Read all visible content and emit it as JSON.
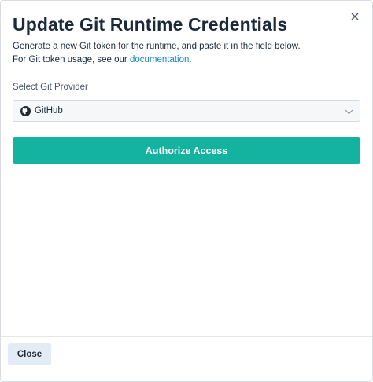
{
  "dialog": {
    "title": "Update Git Runtime Credentials",
    "description_line1": "Generate a new Git token for the runtime, and paste it in the field below.",
    "description_line2_prefix": "For Git token usage, see our ",
    "description_line2_link": "documentation",
    "description_line2_suffix": ".",
    "close_icon": "close-icon"
  },
  "form": {
    "provider_label": "Select Git Provider",
    "provider_value": "GitHub",
    "provider_icon": "github-icon",
    "chevron_icon": "chevron-down-icon"
  },
  "actions": {
    "authorize_label": "Authorize Access",
    "close_label": "Close"
  },
  "colors": {
    "accent": "#14b3a0",
    "link": "#1a84c7",
    "close_button_bg": "#e3ecf5",
    "text": "#1b2a3a"
  }
}
